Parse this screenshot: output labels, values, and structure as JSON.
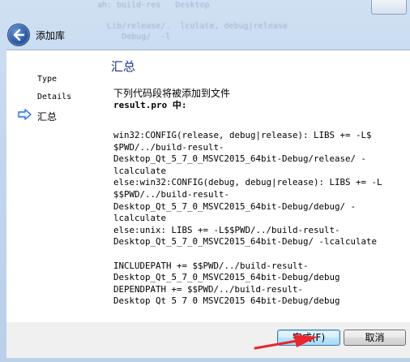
{
  "window": {
    "title": "添加库",
    "background_text": "ah: build-res   Desktop\n\n  Lib/release/.  lculate, debug|release\n     Debug/  -l\n\n   ../build-result-\n     -Debug/debug\n\n\n       Qt 5_7_0   64bit-Debug/release"
  },
  "nav": {
    "items": [
      {
        "label": "Type",
        "active": false
      },
      {
        "label": "Details",
        "active": false
      },
      {
        "label": "汇总",
        "active": true
      }
    ]
  },
  "content": {
    "heading": "汇总",
    "intro": "下列代码段将被添加到文件",
    "filename": "result.pro 中:",
    "code": "win32:CONFIG(release, debug|release): LIBS += -L$\n$PWD/../build-result-\nDesktop_Qt_5_7_0_MSVC2015_64bit-Debug/release/ -\nlcalculate\nelse:win32:CONFIG(debug, debug|release): LIBS += -L\n$$PWD/../build-result-\nDesktop_Qt_5_7_0_MSVC2015_64bit-Debug/debug/ -\nlcalculate\nelse:unix: LIBS += -L$$PWD/../build-result-\nDesktop_Qt_5_7_0_MSVC2015_64bit-Debug/ -lcalculate\n\nINCLUDEPATH += $$PWD/../build-result-\nDesktop_Qt_5_7_0_MSVC2015_64bit-Debug/debug\nDEPENDPATH += $$PWD/../build-result-\nDesktop Qt 5 7 0 MSVC2015 64bit-Debug/debug"
  },
  "footer": {
    "finish_label": "完成(F)",
    "cancel_label": "取消"
  },
  "colors": {
    "heading": "#1e3287",
    "annotation_arrow": "#e8262b",
    "nav_arrow": "#2a6fd6"
  }
}
